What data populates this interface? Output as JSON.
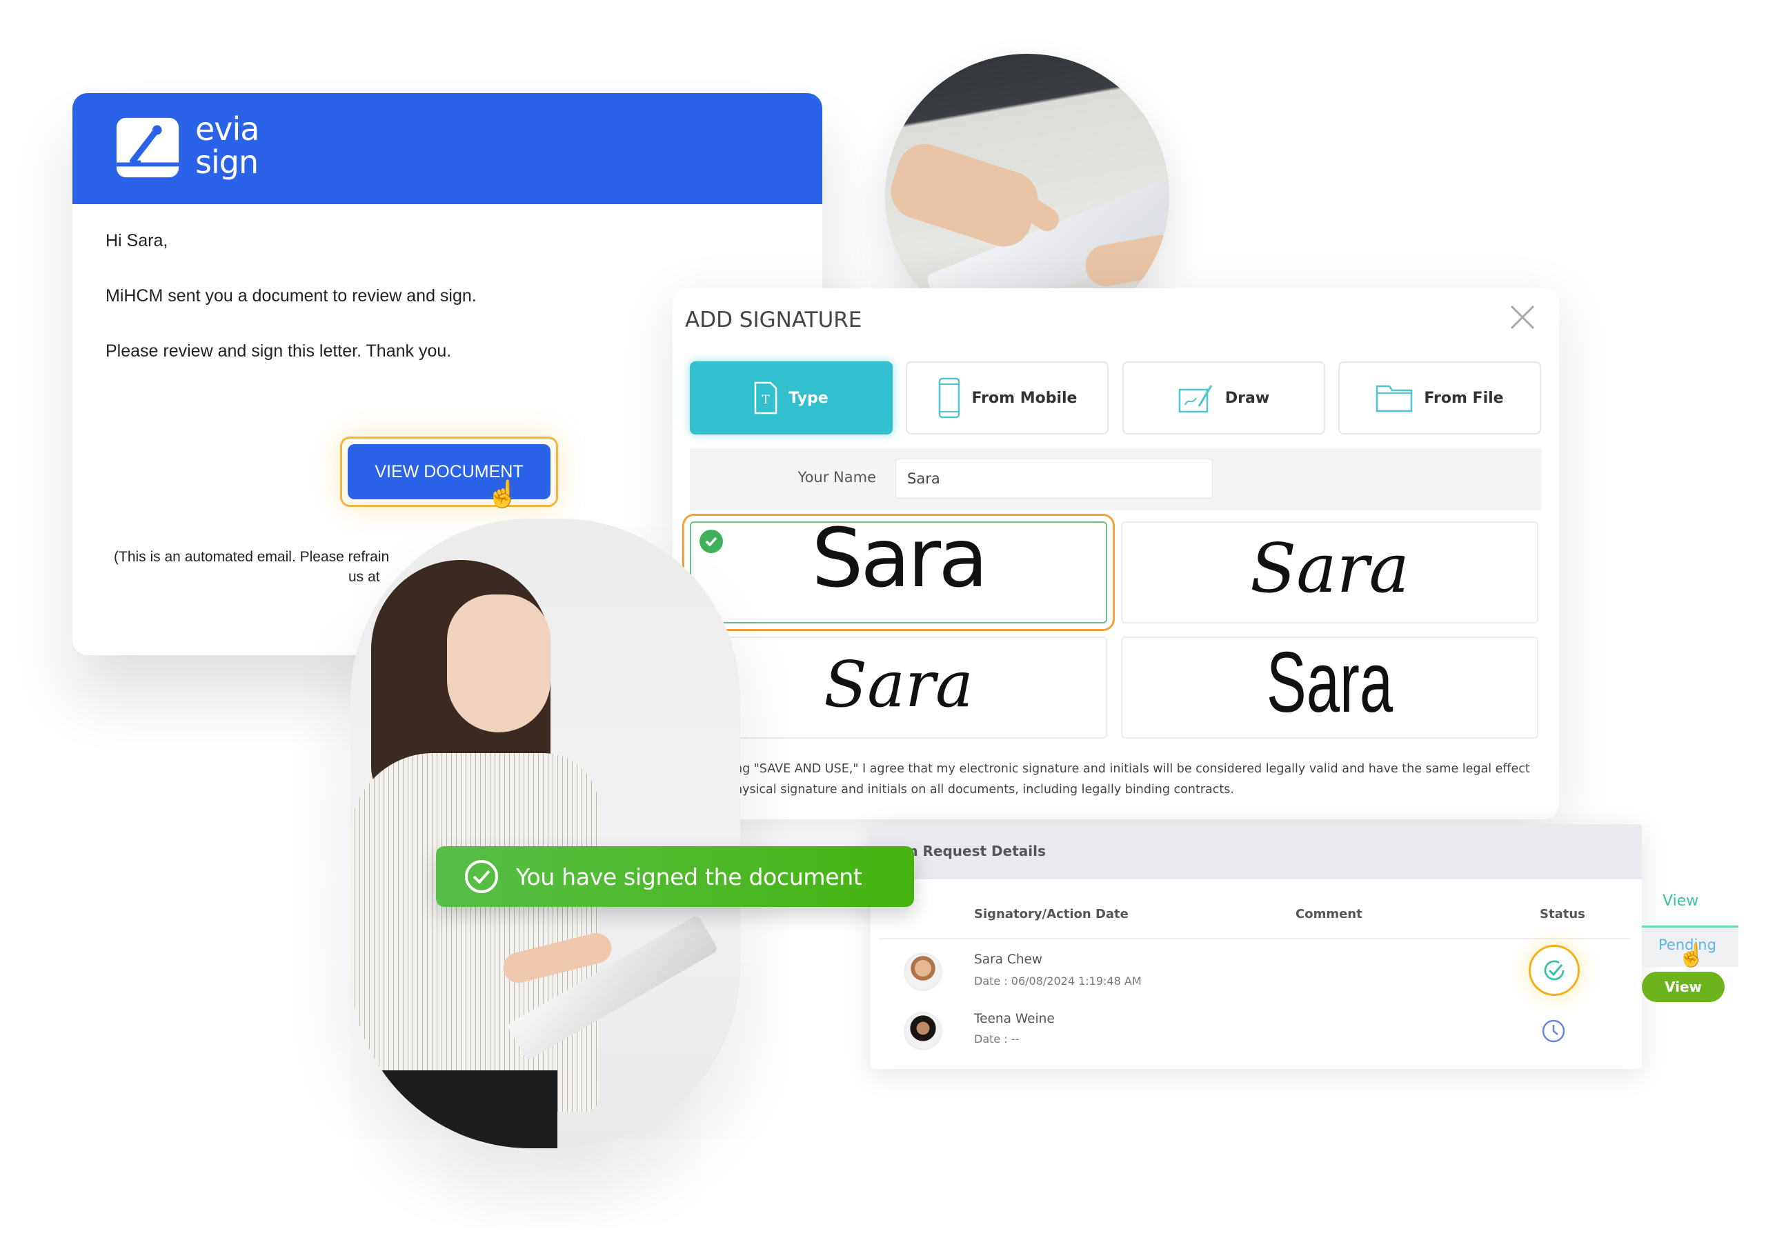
{
  "email": {
    "brand": {
      "line1": "evia",
      "line2": "sign",
      "color": "#2a63e8"
    },
    "greeting": "Hi Sara,",
    "body_line1": "MiHCM sent you a document to review and sign.",
    "body_line2": "Please review and sign this letter. Thank you.",
    "view_button_label": "VIEW DOCUMENT",
    "note_line1": "(This is an automated email. Please refrain",
    "note_line2": "us at"
  },
  "modal": {
    "title": "ADD SIGNATURE",
    "close_icon": "close-icon",
    "tabs": [
      {
        "label": "Type",
        "icon": "text-file-icon",
        "active": true
      },
      {
        "label": "From Mobile",
        "icon": "mobile-phone-icon",
        "active": false
      },
      {
        "label": "Draw",
        "icon": "draw-pen-icon",
        "active": false
      },
      {
        "label": "From File",
        "icon": "folder-icon",
        "active": false
      }
    ],
    "name_label": "Your Name",
    "name_value": "Sara",
    "signature_options": [
      {
        "text": "Sara",
        "selected": true
      },
      {
        "text": "Sara",
        "selected": false
      },
      {
        "text": "Sara",
        "selected": false
      },
      {
        "text": "Sara",
        "selected": false
      }
    ],
    "legal_line1": "ng \"SAVE AND USE,\" I agree that my electronic signature and initials will be considered legally valid and have the same legal effect",
    "legal_line2": "nysical signature and initials on all documents, including legally binding contracts.",
    "accent_color": "#32bfce"
  },
  "toast": {
    "message": "You have signed the document",
    "color": "#4cb92b"
  },
  "details": {
    "title": "gn Request Details",
    "columns": [
      "Signatory/Action Date",
      "Comment",
      "Status"
    ],
    "rows": [
      {
        "name": "Sara Chew",
        "date": "Date : 06/08/2024 1:19:48 AM",
        "comment": "",
        "status": "signed"
      },
      {
        "name": "Teena Weine",
        "date": "Date : --",
        "comment": "",
        "status": "pending"
      }
    ]
  },
  "side_panel": {
    "view_link": "View",
    "pending_link": "Pending",
    "view_button": "View"
  }
}
